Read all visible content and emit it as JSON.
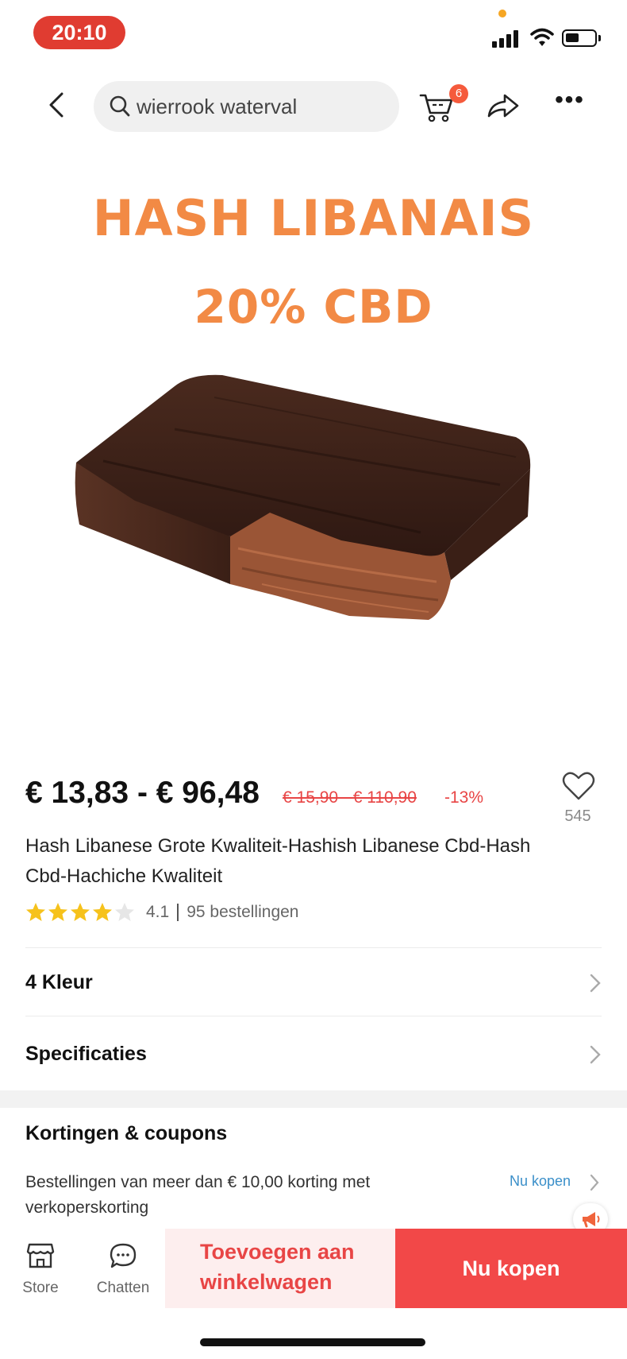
{
  "status_bar": {
    "time": "20:10"
  },
  "nav": {
    "search_text": "wierrook waterval",
    "cart_count": "6"
  },
  "product_image": {
    "promo_line1": "HASH LIBANAIS",
    "promo_line2": "20% CBD"
  },
  "product": {
    "price_range": "€ 13,83 - € 96,48",
    "original_price": "€ 15,90 - € 110,90",
    "discount": "-13%",
    "wishlist_count": "545",
    "title": "Hash Libanese Grote Kwaliteit-Hashish Libanese Cbd-Hash Cbd-Hachiche Kwaliteit",
    "rating": 4.1,
    "rating_text": "4.1",
    "orders": "95 bestellingen"
  },
  "options": {
    "color_label": "4 Kleur",
    "specs_label": "Specificaties"
  },
  "coupons": {
    "title": "Kortingen & coupons",
    "text": "Bestellingen van meer dan € 10,00 korting met verkoperskorting",
    "link": "Nu kopen"
  },
  "action_bar": {
    "store_label": "Store",
    "chat_label": "Chatten",
    "add_to_cart_line1": "Toevoegen aan",
    "add_to_cart_line2": "winkelwagen",
    "buy_now": "Nu kopen"
  },
  "colors": {
    "accent_red": "#f24848",
    "promo_orange": "#f28a45",
    "star_yellow": "#f6c21c",
    "link_blue": "#3a8fc9"
  }
}
